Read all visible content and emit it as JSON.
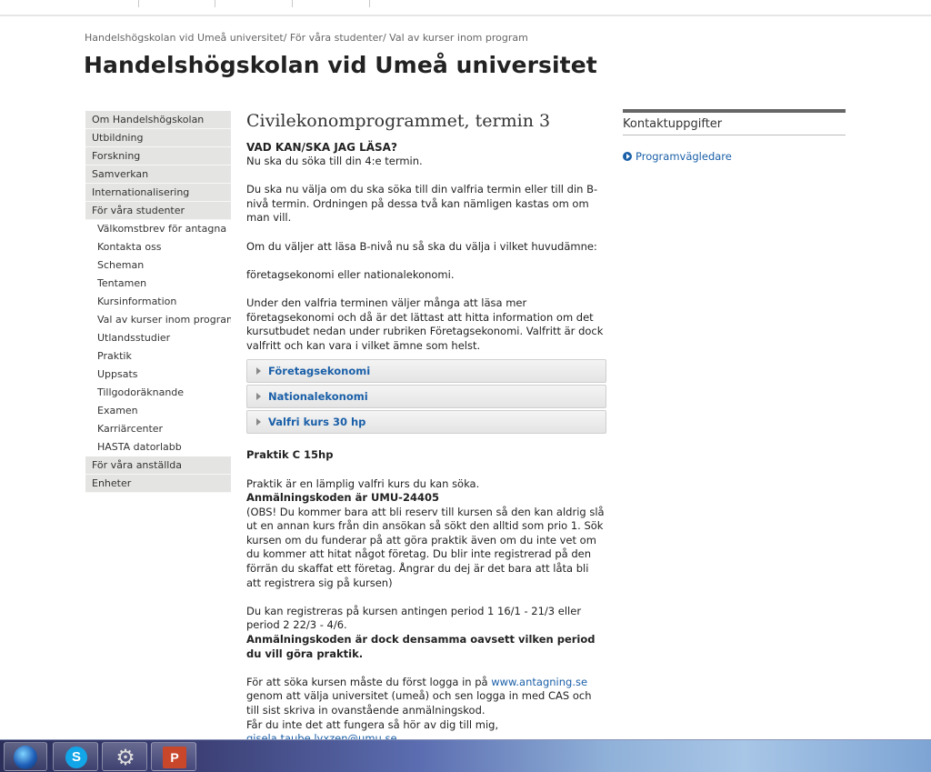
{
  "breadcrumb": {
    "item1": "Handelshögskolan vid Umeå universitet",
    "item2": "För våra studenter",
    "item3": "Val av kurser inom program",
    "sep": "/ "
  },
  "site_title": "Handelshögskolan vid Umeå universitet",
  "sidebar": {
    "items": [
      {
        "label": "Om Handelshögskolan",
        "sub": false
      },
      {
        "label": "Utbildning",
        "sub": false
      },
      {
        "label": "Forskning",
        "sub": false
      },
      {
        "label": "Samverkan",
        "sub": false
      },
      {
        "label": "Internationalisering",
        "sub": false
      },
      {
        "label": "För våra studenter",
        "sub": false
      },
      {
        "label": "Välkomstbrev för antagna",
        "sub": true
      },
      {
        "label": "Kontakta oss",
        "sub": true
      },
      {
        "label": "Scheman",
        "sub": true
      },
      {
        "label": "Tentamen",
        "sub": true
      },
      {
        "label": "Kursinformation",
        "sub": true
      },
      {
        "label": "Val av kurser inom program",
        "sub": true
      },
      {
        "label": "Utlandsstudier",
        "sub": true
      },
      {
        "label": "Praktik",
        "sub": true
      },
      {
        "label": "Uppsats",
        "sub": true
      },
      {
        "label": "Tillgodoräknande",
        "sub": true
      },
      {
        "label": "Examen",
        "sub": true
      },
      {
        "label": "Karriärcenter",
        "sub": true
      },
      {
        "label": "HASTA datorlabb",
        "sub": true
      },
      {
        "label": "För våra anställda",
        "sub": false
      },
      {
        "label": "Enheter",
        "sub": false
      }
    ]
  },
  "main": {
    "title": "Civilekonomprogrammet, termin 3",
    "question": "VAD KAN/SKA JAG LÄSA?",
    "p1": "Nu ska du söka till din 4:e termin.",
    "p2": "Du ska nu välja om du ska söka till din valfria termin eller till din B-nivå termin. Ordningen på dessa två kan nämligen kastas om om man vill.",
    "p3": "Om du väljer att läsa B-nivå nu så ska du välja i vilket huvudämne:",
    "p4": "företagsekonomi eller nationalekonomi.",
    "p5": "Under den valfria terminen väljer många att läsa mer företagsekonomi och då är det lättast att hitta information om det kursutbudet nedan under rubriken Företagsekonomi. Valfritt är dock valfritt och kan vara i vilket ämne som helst.",
    "accordion": [
      "Företagsekonomi",
      "Nationalekonomi",
      "Valfri kurs 30 hp"
    ],
    "praktik_head": "Praktik C 15hp",
    "praktik_p1": "Praktik är en lämplig valfri kurs du kan söka.",
    "praktik_code": "Anmälningskoden är UMU-24405",
    "praktik_obs": "(OBS! Du kommer bara att bli reserv till kursen så den kan aldrig slå ut en annan kurs från din ansökan så sökt den alltid som prio 1. Sök kursen om du funderar på att göra praktik även om du inte vet om du kommer att hitat något företag. Du blir inte registrerad på den förrän du skaffat ett företag. Ångrar du dej är det bara att låta bli att registrera sig på kursen)",
    "period_text": "Du kan registreras på kursen antingen period 1   16/1 - 21/3 eller period 2   22/3 - 4/6.",
    "period_bold": "Anmälningskoden är dock densamma oavsett vilken period du vill göra praktik.",
    "login_pre": "För att söka kursen måste du först logga in på ",
    "login_link": "www.antagning.se",
    "login_post": " genom att välja universitet (umeå) och sen logga in med CAS och till sist skriva in ovanstående anmälningskod.",
    "help_text": "Får du inte det att fungera så hör av dig till mig,",
    "email": "gisela.taube.lyxzen@umu.se"
  },
  "contact": {
    "heading": "Kontaktuppgifter",
    "link": "Programvägledare"
  },
  "taskbar": {
    "apps": [
      "start-orb",
      "skype",
      "settings",
      "powerpoint"
    ],
    "skype_glyph": "S",
    "gear_glyph": "⚙",
    "ppt_glyph": "P"
  }
}
